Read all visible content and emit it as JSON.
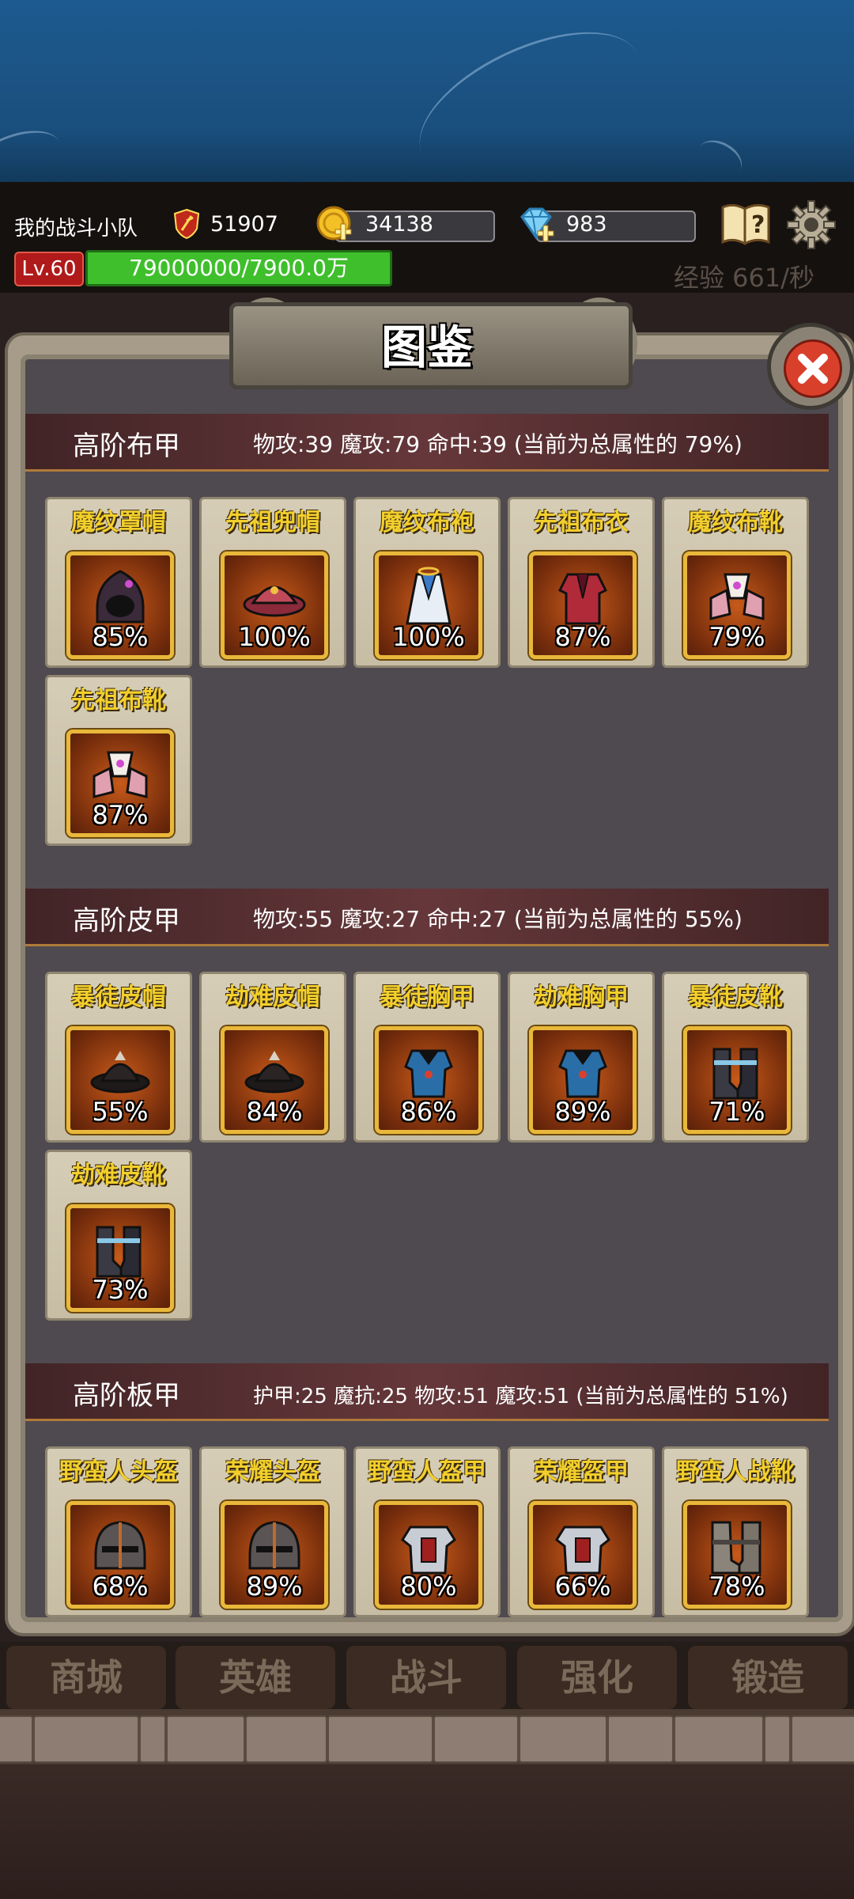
{
  "header": {
    "team_name": "我的战斗小队",
    "power": "51907",
    "gold": "34138",
    "gems": "983",
    "level": "Lv.60",
    "exp": "79000000/7900.0万",
    "exp_rate": "经验 661/秒",
    "icons": [
      "power-shield-icon",
      "coin-plus-icon",
      "gem-plus-icon",
      "guide-book-icon",
      "gear-icon"
    ]
  },
  "panel": {
    "title": "图鉴"
  },
  "sections": [
    {
      "name": "高阶布甲",
      "stats": "物攻:39  魔攻:79  命中:39 (当前为总属性的 79%)",
      "items": [
        {
          "name": "魔纹罩帽",
          "pct": "85%",
          "icon": "hood-icon"
        },
        {
          "name": "先祖兜帽",
          "pct": "100%",
          "icon": "hat-icon"
        },
        {
          "name": "魔纹布袍",
          "pct": "100%",
          "icon": "robe-icon"
        },
        {
          "name": "先祖布衣",
          "pct": "87%",
          "icon": "cloth-armor-icon"
        },
        {
          "name": "魔纹布靴",
          "pct": "79%",
          "icon": "cloth-boots-icon"
        },
        {
          "name": "先祖布靴",
          "pct": "87%",
          "icon": "cloth-boots-icon"
        }
      ]
    },
    {
      "name": "高阶皮甲",
      "stats": "物攻:55  魔攻:27  命中:27 (当前为总属性的 55%)",
      "items": [
        {
          "name": "暴徒皮帽",
          "pct": "55%",
          "icon": "leather-hat-icon"
        },
        {
          "name": "劫难皮帽",
          "pct": "84%",
          "icon": "leather-hat-icon"
        },
        {
          "name": "暴徒胸甲",
          "pct": "86%",
          "icon": "chest-armor-icon"
        },
        {
          "name": "劫难胸甲",
          "pct": "89%",
          "icon": "chest-armor-icon"
        },
        {
          "name": "暴徒皮靴",
          "pct": "71%",
          "icon": "leather-boots-icon"
        },
        {
          "name": "劫难皮靴",
          "pct": "73%",
          "icon": "leather-boots-icon"
        }
      ]
    },
    {
      "name": "高阶板甲",
      "stats": "护甲:25  魔抗:25  物攻:51  魔攻:51 (当前为总属性的 51%)",
      "items": [
        {
          "name": "野蛮人头盔",
          "pct": "68%",
          "icon": "helmet-icon"
        },
        {
          "name": "荣耀头盔",
          "pct": "89%",
          "icon": "helmet-icon"
        },
        {
          "name": "野蛮人盔甲",
          "pct": "80%",
          "icon": "plate-armor-icon"
        },
        {
          "name": "荣耀盔甲",
          "pct": "66%",
          "icon": "plate-armor-icon"
        },
        {
          "name": "野蛮人战靴",
          "pct": "78%",
          "icon": "plate-boots-icon"
        }
      ]
    }
  ],
  "nav": [
    {
      "label": "商城"
    },
    {
      "label": "英雄"
    },
    {
      "label": "战斗"
    },
    {
      "label": "强化"
    },
    {
      "label": "锻造"
    }
  ]
}
